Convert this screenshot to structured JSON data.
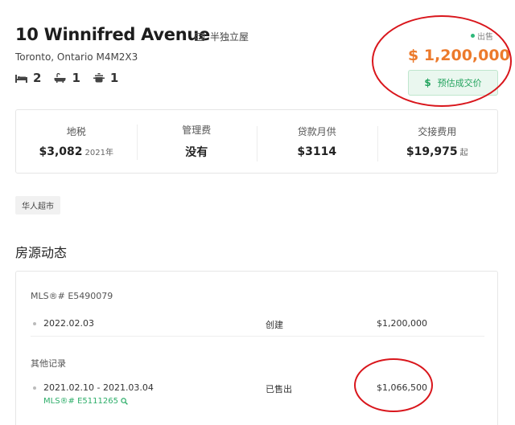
{
  "listing": {
    "title": "10 Winnifred Avenue",
    "property_type": "半独立屋",
    "address": "Toronto, Ontario M4M2X3",
    "bedrooms": "2",
    "bathrooms": "1",
    "kitchens": "1",
    "status": "出售",
    "price": "$ 1,200,000",
    "estimate_label": "预估成交价",
    "estimate_symbol": "$"
  },
  "stats": [
    {
      "label": "地税",
      "value": "$3,082",
      "sub": "2021年"
    },
    {
      "label": "管理费",
      "value": "没有",
      "sub": ""
    },
    {
      "label": "贷款月供",
      "value": "$3114",
      "sub": ""
    },
    {
      "label": "交接费用",
      "value": "$19,975",
      "sub": "起"
    }
  ],
  "tags": [
    "华人超市"
  ],
  "history": {
    "section_title": "房源动态",
    "mls_heading": "MLS®# E5490079",
    "current": {
      "date": "2022.02.03",
      "event": "创建",
      "amount": "$1,200,000"
    },
    "other_heading": "其他记录",
    "other": [
      {
        "date": "2021.02.10 - 2021.03.04",
        "event": "已售出",
        "amount": "$1,066,500",
        "mls": "MLS®# E5111265"
      }
    ]
  },
  "colors": {
    "price": "#ec7a2c",
    "accent_green": "#23a35e",
    "annotation_red": "#d9161c"
  },
  "icons": {
    "property_type": "building-icon",
    "bedroom": "bed-icon",
    "bathroom": "bathtub-icon",
    "kitchen": "cooking-pot-icon",
    "mls_link": "search-icon"
  }
}
